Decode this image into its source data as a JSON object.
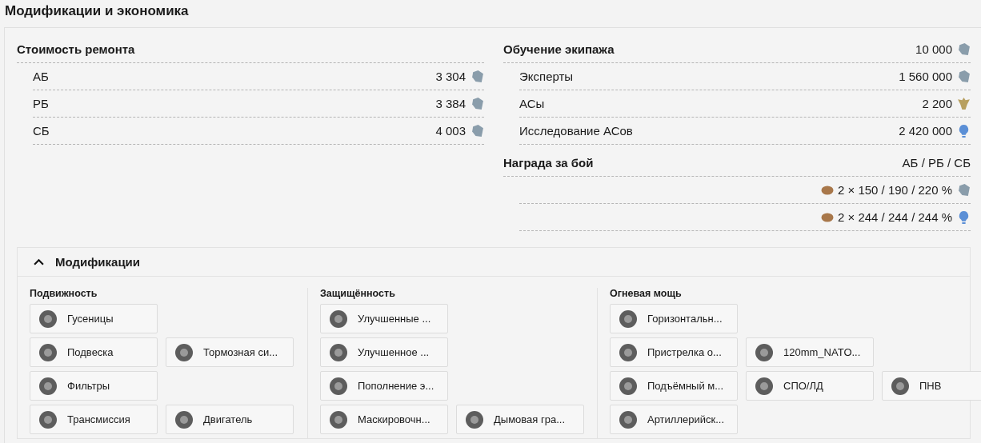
{
  "title": "Модификации и экономика",
  "repair": {
    "heading": "Стоимость ремонта",
    "rows": [
      {
        "label": "АБ",
        "value": "3 304",
        "kind": "silver"
      },
      {
        "label": "РБ",
        "value": "3 384",
        "kind": "silver"
      },
      {
        "label": "СБ",
        "value": "4 003",
        "kind": "silver"
      }
    ]
  },
  "crew": {
    "heading": "Обучение экипажа",
    "value": "10 000",
    "kind": "silver",
    "rows": [
      {
        "label": "Эксперты",
        "value": "1 560 000",
        "kind": "silver"
      },
      {
        "label": "АСы",
        "value": "2 200",
        "kind": "gold"
      },
      {
        "label": "Исследование АСов",
        "value": "2 420 000",
        "kind": "rp"
      }
    ]
  },
  "reward": {
    "heading": "Награда за бой",
    "modes": "АБ / РБ / СБ",
    "rows": [
      {
        "value": "2 × 150 / 190 / 220 %",
        "kind": "silver"
      },
      {
        "value": "2 × 244 / 244 / 244 %",
        "kind": "rp"
      }
    ]
  },
  "modifications": {
    "title": "Модификации",
    "expanded": true,
    "groups": [
      {
        "title": "Подвижность",
        "rows": [
          [
            "Гусеницы"
          ],
          [
            "Подвеска",
            "Тормозная си..."
          ],
          [
            "Фильтры"
          ],
          [
            "Трансмиссия",
            "Двигатель"
          ]
        ]
      },
      {
        "title": "Защищённость",
        "rows": [
          [
            "Улучшенные ..."
          ],
          [
            "Улучшенное ..."
          ],
          [
            "Пополнение э..."
          ],
          [
            "Маскировочн...",
            "Дымовая гра..."
          ]
        ]
      },
      {
        "title": "Огневая мощь",
        "rows": [
          [
            "Горизонтальн..."
          ],
          [
            "Пристрелка о...",
            "120mm_NATO..."
          ],
          [
            "Подъёмный м...",
            "СПО/ЛД",
            "ПНВ"
          ],
          [
            "Артиллерийск..."
          ]
        ]
      }
    ]
  }
}
